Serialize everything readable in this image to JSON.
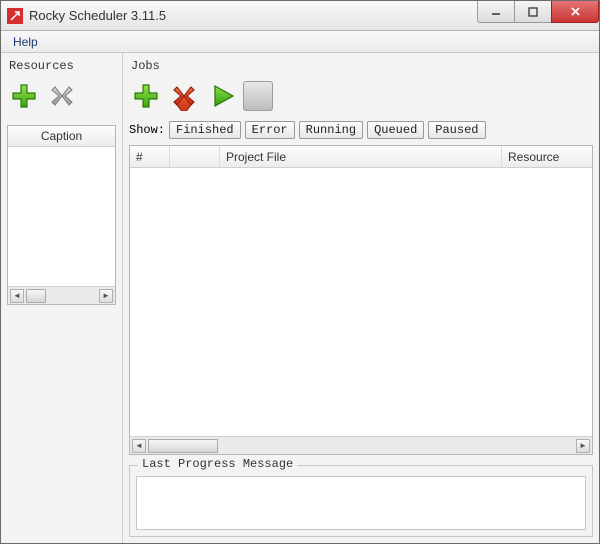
{
  "window": {
    "title": "Rocky Scheduler 3.11.5"
  },
  "menubar": {
    "help": "Help"
  },
  "resources": {
    "title": "Resources",
    "caption_header": "Caption"
  },
  "jobs": {
    "title": "Jobs",
    "show_label": "Show:",
    "filters": {
      "finished": "Finished",
      "error": "Error",
      "running": "Running",
      "queued": "Queued",
      "paused": "Paused"
    },
    "columns": {
      "num": "#",
      "project": "Project File",
      "resource": "Resource"
    },
    "rows": []
  },
  "progress": {
    "title": "Last Progress Message",
    "message": ""
  },
  "icons": {
    "add": "add-icon",
    "delete": "delete-icon",
    "run": "play-icon",
    "stop": "stop-icon"
  }
}
